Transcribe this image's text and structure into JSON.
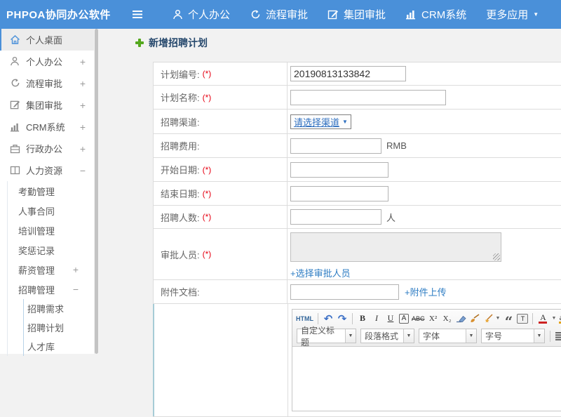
{
  "navbar": {
    "logo": "PHPOA协同办公软件",
    "menu": [
      {
        "label": "个人办公"
      },
      {
        "label": "流程审批"
      },
      {
        "label": "集团审批"
      },
      {
        "label": "CRM系统"
      },
      {
        "label": "更多应用"
      }
    ],
    "caret": "▼"
  },
  "sidebar": {
    "items": [
      {
        "label": "个人桌面"
      },
      {
        "label": "个人办公",
        "expand": "+"
      },
      {
        "label": "流程审批",
        "expand": "+"
      },
      {
        "label": "集团审批",
        "expand": "+"
      },
      {
        "label": "CRM系统",
        "expand": "+"
      },
      {
        "label": "行政办公",
        "expand": "+"
      },
      {
        "label": "人力资源",
        "expand": "−"
      }
    ],
    "hr_submenu": [
      {
        "label": "考勤管理"
      },
      {
        "label": "人事合同"
      },
      {
        "label": "培训管理"
      },
      {
        "label": "奖惩记录"
      },
      {
        "label": "薪资管理",
        "expand": "+"
      },
      {
        "label": "招聘管理",
        "expand": "−"
      }
    ],
    "recruit_submenu": [
      {
        "label": "招聘需求"
      },
      {
        "label": "招聘计划"
      },
      {
        "label": "人才库"
      }
    ]
  },
  "main": {
    "title": "新增招聘计划",
    "required_mark": "(*)",
    "form": {
      "plan_no": {
        "label": "计划编号:",
        "value": "20190813133842"
      },
      "plan_name": {
        "label": "计划名称:"
      },
      "channel": {
        "label": "招聘渠道:",
        "select_value": "请选择渠道"
      },
      "cost": {
        "label": "招聘费用:",
        "suffix": "RMB"
      },
      "start_date": {
        "label": "开始日期:"
      },
      "end_date": {
        "label": "结束日期:"
      },
      "headcount": {
        "label": "招聘人数:",
        "suffix": "人"
      },
      "approver": {
        "label": "审批人员:",
        "link": "+选择审批人员"
      },
      "attachment": {
        "label": "附件文档:",
        "link": "+附件上传"
      }
    },
    "editor": {
      "html_btn": "HTML",
      "undo": "↶",
      "redo": "↷",
      "bold": "B",
      "italic": "I",
      "underline": "U",
      "boxed_a": "A",
      "strike": "ABC",
      "superscript": "X²",
      "subscript": "X₂",
      "quote": "“",
      "paste_t": "T",
      "font_color": "A",
      "highlight": "ab",
      "combo_title": "自定义标题",
      "combo_paragraph": "段落格式",
      "combo_font": "字体",
      "combo_size": "字号"
    }
  },
  "colors": {
    "navbar_blue": "#4a90d9",
    "link_blue": "#2d7cc3",
    "title_navy": "#27496d",
    "required_red": "#e60012",
    "add_green": "#55a81e"
  }
}
